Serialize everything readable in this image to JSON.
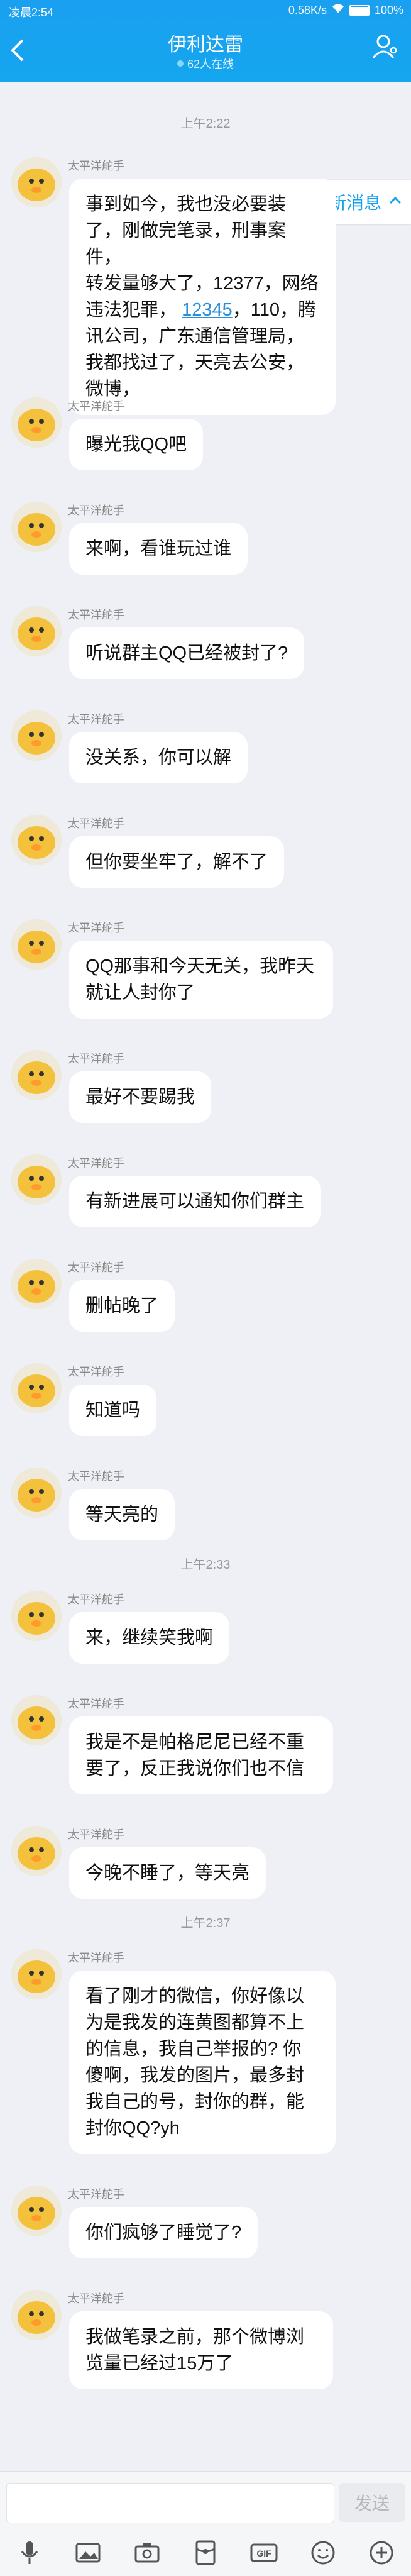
{
  "status": {
    "time": "凌晨2:54",
    "network_speed": "0.58K/s",
    "battery": "100%"
  },
  "header": {
    "title": "伊利达雷",
    "subtitle": "62人在线"
  },
  "new_messages_badge": "31条新消息",
  "timestamps": [
    "上午2:22",
    "上午2:33",
    "上午2:37"
  ],
  "sender_name": "太平洋舵手",
  "messages": [
    {
      "lines": [
        "事到如今，我也没必要装",
        "了，刚做完笔录，刑事案件，",
        "转发量够大了，12377，网络",
        "违法犯罪，",
        "腾",
        "讯公司，广东通信管理局，",
        "我都找过了，天亮去公安，",
        "微博，"
      ],
      "link": "12345",
      "after_link": "，110，"
    },
    {
      "text": "曝光我QQ吧"
    },
    {
      "text": "来啊，看谁玩过谁"
    },
    {
      "text": "听说群主QQ已经被封了?"
    },
    {
      "text": "没关系，你可以解"
    },
    {
      "text": "但你要坐牢了，解不了"
    },
    {
      "lines": [
        "QQ那事和今天无关，我昨天",
        "就让人封你了"
      ]
    },
    {
      "text": "最好不要踢我"
    },
    {
      "text": "有新进展可以通知你们群主"
    },
    {
      "text": "删帖晚了"
    },
    {
      "text": "知道吗"
    },
    {
      "text": "等天亮的"
    },
    {
      "text": "来，继续笑我啊"
    },
    {
      "lines": [
        "我是不是帕格尼尼已经不重",
        "要了，反正我说你们也不信"
      ]
    },
    {
      "text": "今晚不睡了，等天亮"
    },
    {
      "lines": [
        "看了刚才的微信，你好像以",
        "为是我发的连黄图都算不上",
        "的信息，我自己举报的? 你",
        "傻啊，我发的图片，最多封",
        "我自己的号，封你的群，能",
        "封你QQ?yh"
      ]
    },
    {
      "text": "你们疯够了睡觉了?"
    },
    {
      "lines": [
        "我做笔录之前，那个微博浏",
        "览量已经过15万了"
      ]
    }
  ],
  "input": {
    "send_label": "发送",
    "placeholder": ""
  },
  "toolbar_icons": [
    "microphone-icon",
    "image-icon",
    "camera-icon",
    "red-packet-icon",
    "gif-icon",
    "emoji-icon",
    "plus-icon"
  ],
  "colors": {
    "header": "#14a6ef",
    "link": "#2a8fd6",
    "background": "#eef0f5"
  }
}
